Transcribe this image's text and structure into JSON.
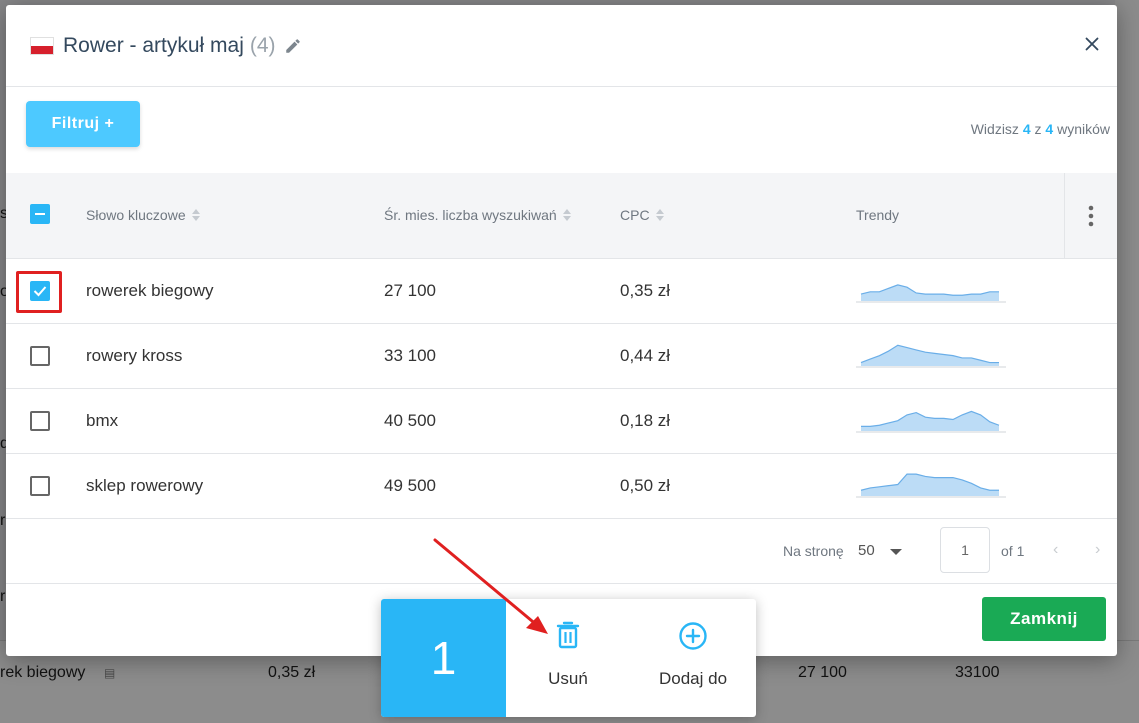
{
  "background": {
    "row_keyword": "rek biegowy",
    "row_cpc": "0,35 zł",
    "row_volume": "27 100",
    "row_extra": "33100",
    "left_fragments": [
      "s",
      "o",
      "d",
      "r",
      "r"
    ]
  },
  "modal": {
    "title": "Rower - artykuł maj",
    "count": "(4)",
    "filter_label": "Filtruj +",
    "results": {
      "prefix": "Widzisz",
      "shown": "4",
      "middle": "z",
      "total": "4",
      "suffix": "wyników"
    },
    "columns": {
      "keyword": "Słowo kluczowe",
      "volume": "Śr. mies. liczba wyszukiwań",
      "cpc": "CPC",
      "trends": "Trendy"
    },
    "rows": [
      {
        "keyword": "rowerek biegowy",
        "volume": "27 100",
        "cpc": "0,35 zł",
        "checked": true,
        "trend": [
          6,
          8,
          8,
          11,
          14,
          12,
          7,
          6,
          6,
          6,
          5,
          5,
          6,
          6,
          8,
          8
        ]
      },
      {
        "keyword": "rowery kross",
        "volume": "33 100",
        "cpc": "0,44 zł",
        "checked": false,
        "trend": [
          3,
          6,
          9,
          13,
          18,
          16,
          14,
          12,
          11,
          10,
          9,
          7,
          7,
          5,
          3,
          3
        ]
      },
      {
        "keyword": "bmx",
        "volume": "40 500",
        "cpc": "0,18 zł",
        "checked": false,
        "trend": [
          4,
          4,
          5,
          7,
          9,
          14,
          16,
          12,
          11,
          11,
          10,
          14,
          17,
          14,
          8,
          5
        ]
      },
      {
        "keyword": "sklep rowerowy",
        "volume": "49 500",
        "cpc": "0,50 zł",
        "checked": false,
        "trend": [
          5,
          7,
          8,
          9,
          10,
          19,
          19,
          17,
          16,
          16,
          16,
          14,
          11,
          7,
          5,
          5
        ]
      }
    ],
    "pager": {
      "per_page_label": "Na stronę",
      "per_page": "50",
      "page": "1",
      "of": "of 1",
      "prev": "‹",
      "next": "›"
    },
    "close_label": "Zamknij"
  },
  "selection": {
    "count": "1",
    "delete_label": "Usuń",
    "add_label": "Dodaj do"
  },
  "colors": {
    "accent": "#29b6f6",
    "filter_button": "#4dc9ff",
    "close_button": "#1aaa55",
    "highlight": "#e02020",
    "spark_fill": "#bcdcf6",
    "spark_line": "#6aaee8"
  }
}
